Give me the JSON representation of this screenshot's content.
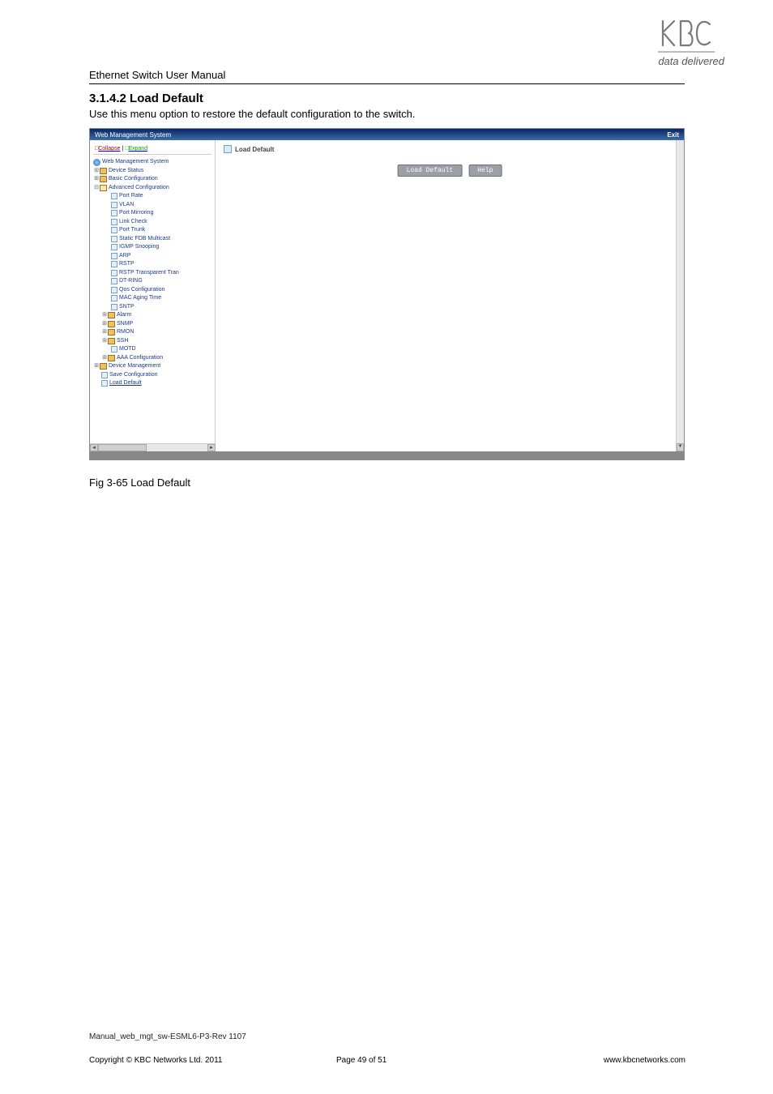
{
  "logo": {
    "tagline": "data delivered"
  },
  "doc": {
    "title": "Ethernet Switch User Manual"
  },
  "section": {
    "heading": "3.1.4.2 Load Default",
    "text": "Use this menu option to restore the default configuration to the switch."
  },
  "screenshot": {
    "titlebar": "Web Management System",
    "exit": "Exit",
    "collapse": "Collapse",
    "expand": "Expand",
    "separator": " | ",
    "tree": {
      "root": "Web Management System",
      "device_status": "Device Status",
      "basic_config": "Basic Configuration",
      "adv_config": "Advanced Configuration",
      "adv_items": [
        "Port Rate",
        "VLAN",
        "Port Mirroring",
        "Link Check",
        "Port Trunk",
        "Static FDB Multicast",
        "IGMP Snooping",
        "ARP",
        "RSTP",
        "RSTP Transparent Tran",
        "DT-RING",
        "Qos Configuration",
        "MAC Aging Time",
        "SNTP"
      ],
      "alarm": "Alarm",
      "snmp": "SNMP",
      "rmon": "RMON",
      "ssh": "SSH",
      "motd": "MOTD",
      "aaa": "AAA Configuration",
      "device_mgmt": "Device Management",
      "save_config": "Save Configuration",
      "load_default": "Load Default"
    },
    "main": {
      "page_title": "Load Default",
      "btn_load": "Load Default",
      "btn_help": "Help"
    }
  },
  "figure": {
    "caption": "Fig 3-65 Load Default"
  },
  "footer": {
    "file": "Manual_web_mgt_sw-ESML6-P3-Rev 1107",
    "copyright": "Copyright © KBC Networks Ltd. 2011",
    "page": "Page 49 of 51",
    "url": "www.kbcnetworks.com"
  }
}
